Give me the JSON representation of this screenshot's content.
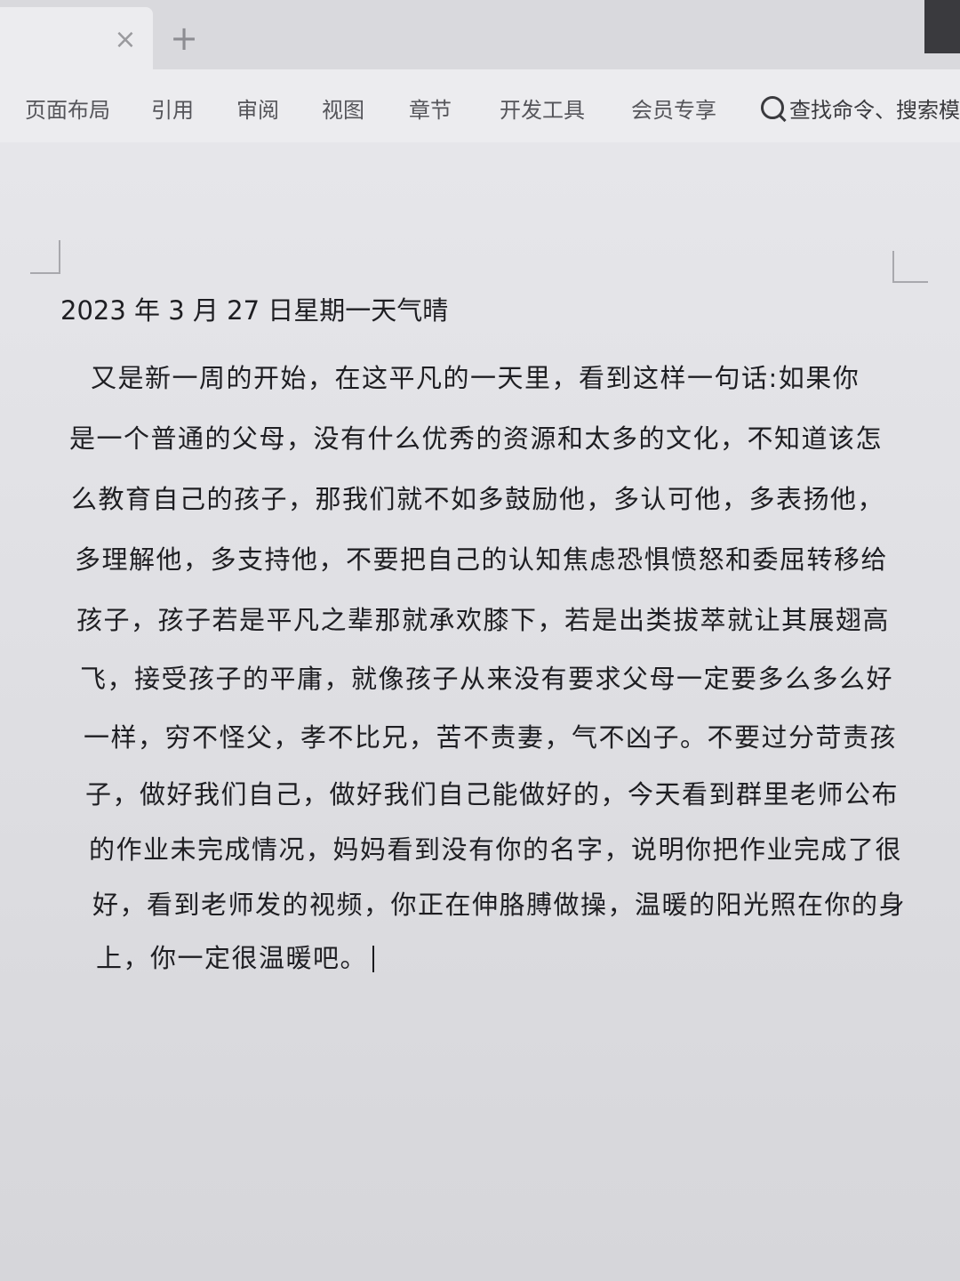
{
  "tabbar": {
    "close_glyph": "×",
    "new_glyph": "+"
  },
  "ribbon": {
    "items": [
      "页面布局",
      "引用",
      "审阅",
      "视图",
      "章节",
      "开发工具",
      "会员专享"
    ],
    "search_text": "查找命令、搜索模板",
    "search_icon": "search-icon"
  },
  "document": {
    "date_line": "2023 年 3 月 27 日星期一天气晴",
    "lines": [
      "又是新一周的开始，在这平凡的一天里，看到这样一句话:如果你",
      "是一个普通的父母，没有什么优秀的资源和太多的文化，不知道该怎",
      "么教育自己的孩子，那我们就不如多鼓励他，多认可他，多表扬他，",
      "多理解他，多支持他，不要把自己的认知焦虑恐惧愤怒和委屈转移给",
      "孩子，孩子若是平凡之辈那就承欢膝下，若是出类拔萃就让其展翅高",
      "飞，接受孩子的平庸，就像孩子从来没有要求父母一定要多么多么好",
      "一样，穷不怪父，孝不比兄，苦不责妻，气不凶子。不要过分苛责孩",
      "子，做好我们自己，做好我们自己能做好的，今天看到群里老师公布",
      "的作业未完成情况，妈妈看到没有你的名字，说明你把作业完成了很",
      "好，看到老师发的视频，你正在伸胳膊做操，温暖的阳光照在你的身",
      "上，你一定很温暖吧。"
    ]
  }
}
